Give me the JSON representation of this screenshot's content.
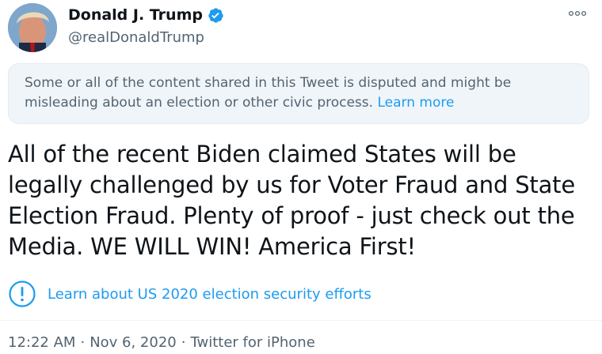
{
  "tweet": {
    "author": {
      "display_name": "Donald J. Trump",
      "handle": "@realDonaldTrump",
      "verified": true
    },
    "notice": {
      "text": "Some or all of the content shared in this Tweet is disputed and might be misleading about an election or other civic process.",
      "link_label": "Learn more"
    },
    "body": "All of the recent Biden claimed States will be legally challenged by us for Voter Fraud and State Election Fraud. Plenty of proof - just check out the Media. WE WILL WIN! America First!",
    "election_link": "Learn about US 2020 election security efforts",
    "meta": {
      "time": "12:22 AM",
      "date": "Nov 6, 2020",
      "client": "Twitter for iPhone"
    }
  },
  "colors": {
    "accent": "#1d9bf0",
    "secondary_text": "#536471",
    "notice_bg": "#f0f5f9"
  },
  "icons": {
    "verified": "verified-badge-icon",
    "more": "more-options-icon",
    "info": "info-icon"
  }
}
